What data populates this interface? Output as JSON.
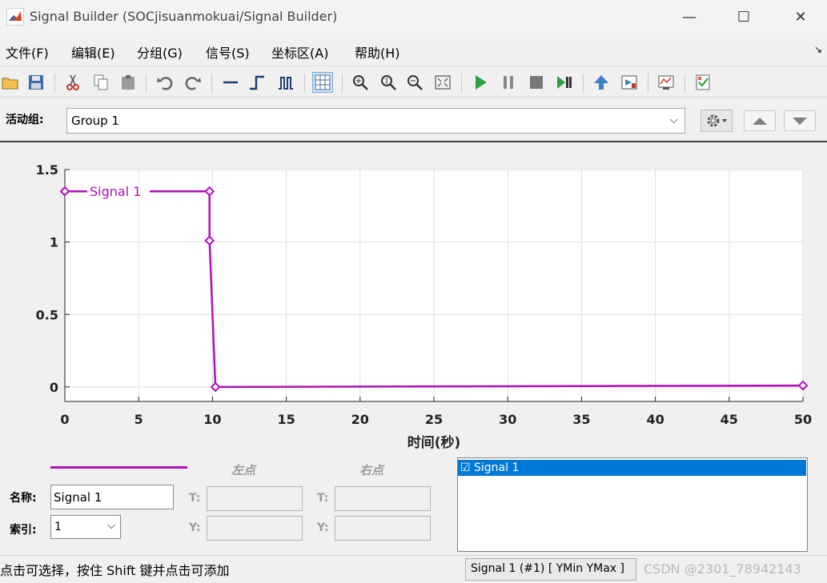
{
  "window": {
    "title": "Signal Builder (SOCjisuanmokuai/Signal Builder)",
    "minimize": "—",
    "maximize": "☐",
    "close": "✕"
  },
  "menu": {
    "items": [
      "文件(F)",
      "编辑(E)",
      "分组(G)",
      "信号(S)",
      "坐标区(A)",
      "帮助(H)"
    ],
    "overflow_arrow": "↘"
  },
  "toolbar": {
    "icons": [
      "open-icon",
      "save-icon",
      "cut-icon",
      "copy-icon",
      "paste-icon",
      "undo-icon",
      "redo-icon",
      "step-line-icon",
      "pulse-up-icon",
      "pulse-train-icon",
      "grid-icon",
      "zoom-xy-icon",
      "zoom-y-icon",
      "zoom-in-icon",
      "fit-view-icon",
      "play-icon",
      "pause-icon",
      "stop-icon",
      "run-all-icon",
      "up-arrow-icon",
      "export-icon",
      "scope-icon",
      "check-icon"
    ]
  },
  "group": {
    "label": "活动组:",
    "selected": "Group 1",
    "chevron": "⌵"
  },
  "chart_data": {
    "type": "line",
    "xlabel": "时间(秒)",
    "ylabel": "",
    "xlim": [
      0,
      50
    ],
    "ylim": [
      -0.1,
      1.5
    ],
    "x_ticks": [
      0,
      5,
      10,
      15,
      20,
      25,
      30,
      35,
      40,
      45,
      50
    ],
    "y_ticks": [
      0,
      0.5,
      1,
      1.5
    ],
    "x_tick_labels": [
      "0",
      "5",
      "10",
      "15",
      "20",
      "25",
      "30",
      "35",
      "40",
      "45",
      "50"
    ],
    "y_tick_labels": [
      "0",
      "0.5",
      "1",
      "1.5"
    ],
    "grid": true,
    "series": [
      {
        "name": "Signal 1",
        "color": "#b10fb9",
        "x": [
          0,
          9.8,
          9.8,
          10.2,
          50
        ],
        "y": [
          1.35,
          1.35,
          1.01,
          0,
          0.01
        ]
      }
    ]
  },
  "props": {
    "left_point": "左点",
    "right_point": "右点",
    "name_label": "名称:",
    "name_value": "Signal 1",
    "index_label": "索引:",
    "index_value": "1",
    "t_label": "T:",
    "y_label": "Y:",
    "t_right_label": "T:",
    "y_right_label": "Y:"
  },
  "signal_list": {
    "items": [
      "☑ Signal 1"
    ]
  },
  "status": {
    "hint": "点击可选择，按住 Shift 键并点击可添加",
    "cell": "Signal 1 (#1)  [ YMin YMax ]",
    "watermark": "CSDN @2301_78942143"
  }
}
